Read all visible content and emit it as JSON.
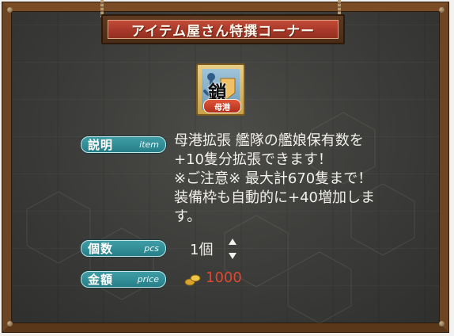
{
  "title": "アイテム屋さん特撰コーナー",
  "item": {
    "icon_kanji": "鎖",
    "icon_badge": "母港",
    "icon_name": "anchor-icon"
  },
  "labels": {
    "description_jp": "説明",
    "description_en": "item",
    "quantity_jp": "個数",
    "quantity_en": "pcs",
    "price_jp": "金額",
    "price_en": "price"
  },
  "description_lines": [
    "母港拡張 艦隊の艦娘保有数を",
    "+10隻分拡張できます！",
    "※ご注意※ 最大計670隻まで！",
    "装備枠も自動的に+40増加しま",
    "す。"
  ],
  "quantity": "1個",
  "price": "1000",
  "colors": {
    "accent_red": "#e0482f",
    "label_teal": "#267f89",
    "title_red": "#a8382a"
  }
}
